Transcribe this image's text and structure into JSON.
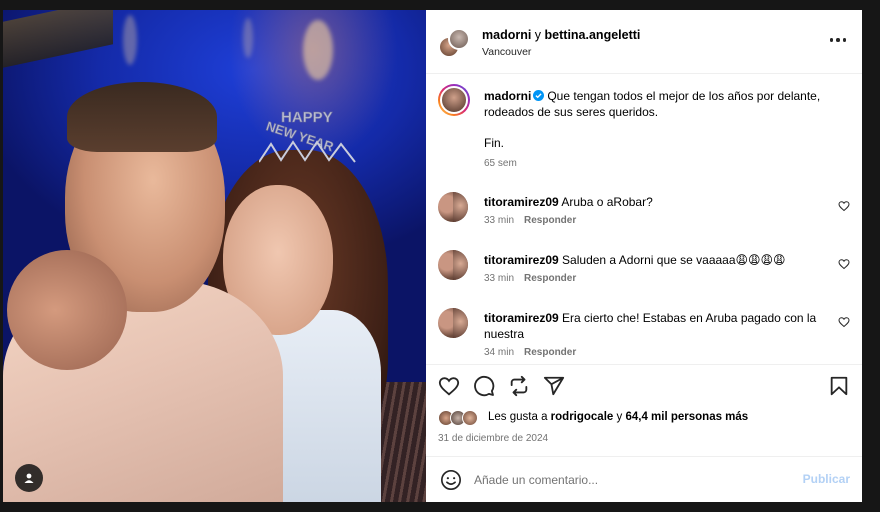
{
  "photo": {
    "tiara_text_top": "HAPPY",
    "tiara_text_bottom": "NEW YEAR"
  },
  "header": {
    "user1": "madorni",
    "connector": "y",
    "user2": "bettina.angeletti",
    "location": "Vancouver",
    "more_icon": "more-horizontal-icon"
  },
  "caption": {
    "username": "madorni",
    "verified": true,
    "text": "Que tengan todos el mejor de los años por delante, rodeados de sus seres queridos.",
    "text2": "Fin.",
    "time": "65 sem"
  },
  "comments": [
    {
      "username": "titoramirez09",
      "text": "Aruba o aRobar?",
      "time": "33 min",
      "reply": "Responder"
    },
    {
      "username": "titoramirez09",
      "text": "Saluden a Adorni que se vaaaaa😩😩😩😩",
      "time": "33 min",
      "reply": "Responder"
    },
    {
      "username": "titoramirez09",
      "text": "Era cierto che! Estabas en Aruba pagado con la nuestra",
      "time": "34 min",
      "reply": "Responder"
    }
  ],
  "actions": {
    "like_icon": "heart-icon",
    "comment_icon": "comment-icon",
    "repost_icon": "repost-icon",
    "share_icon": "send-icon",
    "save_icon": "bookmark-icon"
  },
  "likes": {
    "prefix": "Les gusta a",
    "user": "rodrigocale",
    "middle": "y",
    "count": "64,4 mil personas más"
  },
  "post_date": "31 de diciembre de 2024",
  "add_comment": {
    "placeholder": "Añade un comentario...",
    "publish_label": "Publicar"
  },
  "colors": {
    "verified": "#0095f6",
    "publish_disabled": "#b3d1f5",
    "secondary_text": "#737373"
  }
}
